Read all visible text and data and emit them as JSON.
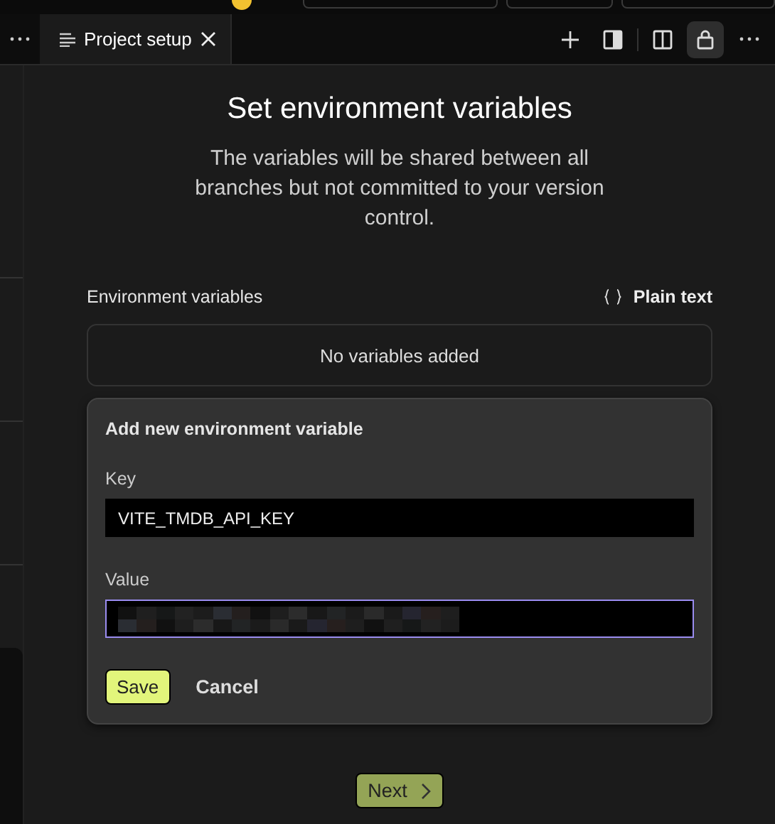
{
  "tab_bar": {
    "tabs": [
      {
        "label": "Project setup",
        "selected": true
      }
    ],
    "toolbar": [
      {
        "kind": "plus",
        "selected": false
      },
      {
        "kind": "panel",
        "selected": false
      },
      {
        "kind": "split",
        "selected": false
      },
      {
        "kind": "lock",
        "selected": true
      }
    ]
  },
  "title": "Set environment variables",
  "description": "The variables will be shared between all branches but not committed to your version control.",
  "variables": {
    "label": "Environment variables",
    "mode_button": "Plain text",
    "empty_text": "No variables added"
  },
  "new_variable": {
    "title": "Add new environment variable",
    "fields": [
      {
        "label": "Key",
        "value": "VITE_TMDB_API_KEY",
        "focused": false,
        "redacted": false
      },
      {
        "label": "Value",
        "focused": true,
        "redacted": true
      }
    ],
    "save": "Save",
    "cancel": "Cancel"
  },
  "next": {
    "label": "Next",
    "disabled": true
  }
}
